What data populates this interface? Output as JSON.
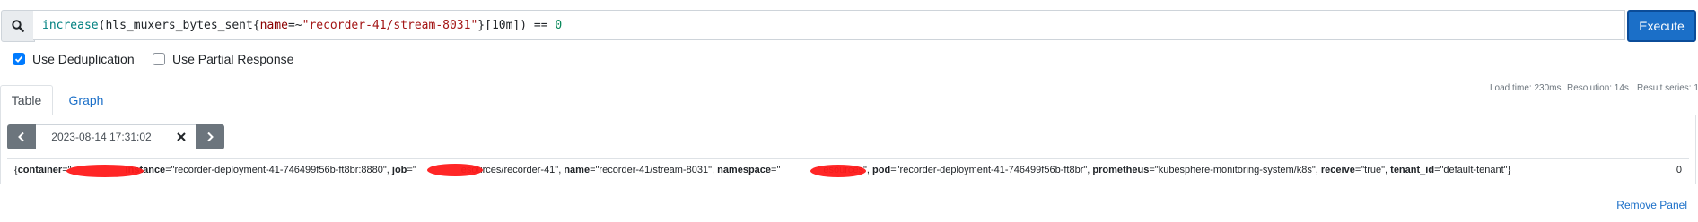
{
  "query": {
    "fn": "increase",
    "open": "(",
    "metric": "hls_muxers_bytes_sent",
    "brace_open": "{",
    "label_name": "name",
    "operator": "=~",
    "label_value": "\"recorder-41/stream-8031\"",
    "brace_close": "}",
    "range": "[10m]",
    "close": ")",
    "comparison": " == ",
    "number": "0"
  },
  "toolbar": {
    "execute_label": "Execute"
  },
  "options": {
    "dedup_label": "Use Deduplication",
    "dedup_checked": true,
    "partial_label": "Use Partial Response",
    "partial_checked": false
  },
  "tabs": [
    {
      "label": "Table",
      "active": true
    },
    {
      "label": "Graph",
      "active": false
    }
  ],
  "stats": {
    "load_time": "Load time: 230ms",
    "resolution": "Resolution: 14s",
    "result_series": "Result series: 1"
  },
  "time_control": {
    "value": "2023-08-14 17:31:02"
  },
  "result": {
    "k_container": "container",
    "v_container": "=\"",
    "k_instance": "instance",
    "v_instance": "=\"recorder-deployment-41-746499f56b-ft8br:8880\", ",
    "k_job": "job",
    "v_job": "=\"",
    "v_job_tail": "esources/recorder-41\", ",
    "k_name": "name",
    "v_name": "=\"recorder-41/stream-8031\", ",
    "k_namespace": "namespace",
    "v_namespace": "=\"",
    "v_namespace_tail": "esources\", ",
    "k_pod": "pod",
    "v_pod": "=\"recorder-deployment-41-746499f56b-ft8br\", ",
    "k_prometheus": "prometheus",
    "v_prometheus": "=\"kubesphere-monitoring-system/k8s\", ",
    "k_receive": "receive",
    "v_receive": "=\"true\", ",
    "k_tenant": "tenant_id",
    "v_tenant": "=\"default-tenant\"}",
    "value": "0"
  },
  "panel": {
    "remove_label": "Remove Panel"
  },
  "colors": {
    "accent": "#1b6fc8",
    "checkbox": "#007bff",
    "redaction": "#ff1a1a"
  }
}
